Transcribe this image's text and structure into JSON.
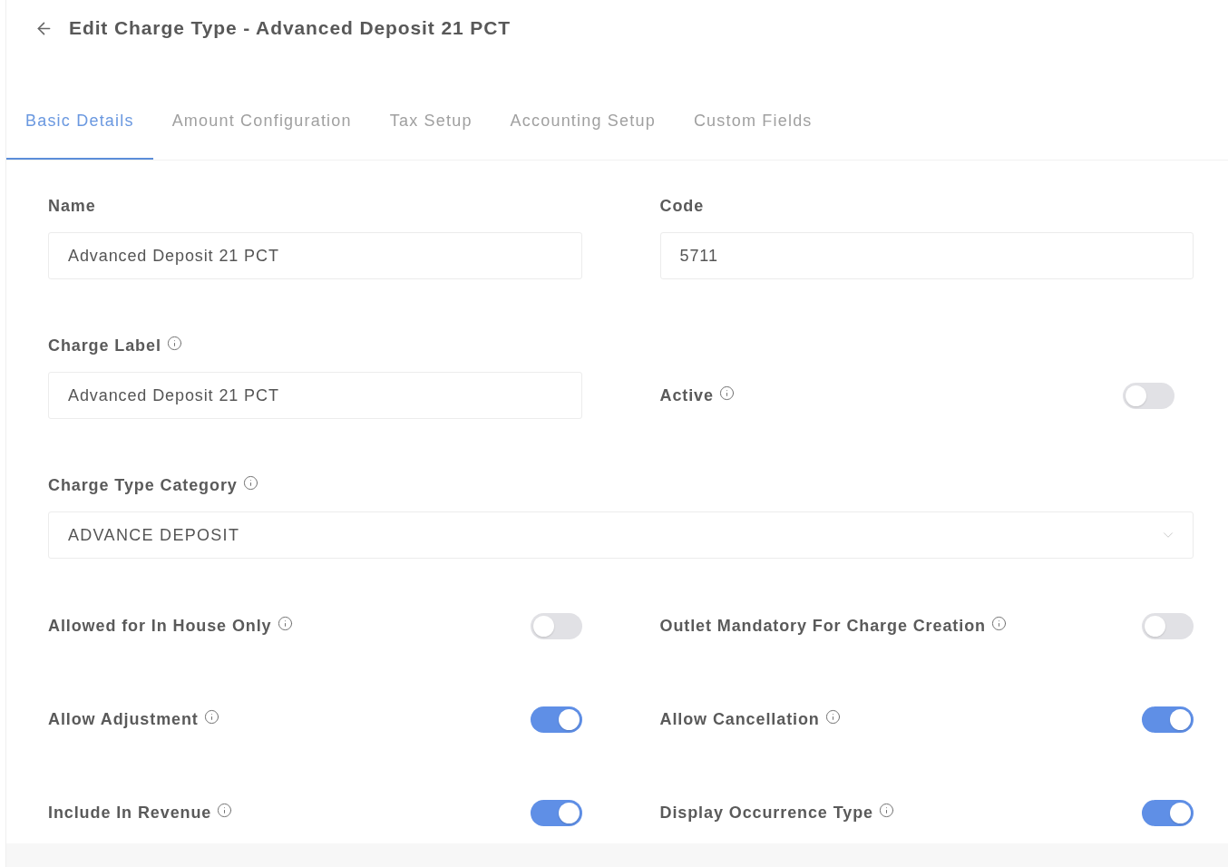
{
  "header": {
    "title": "Edit Charge Type - Advanced Deposit 21 PCT"
  },
  "tabs": [
    {
      "label": "Basic Details",
      "selected": true
    },
    {
      "label": "Amount Configuration",
      "selected": false
    },
    {
      "label": "Tax Setup",
      "selected": false
    },
    {
      "label": "Accounting Setup",
      "selected": false
    },
    {
      "label": "Custom Fields",
      "selected": false
    }
  ],
  "form": {
    "rows": [
      {
        "fields": [
          {
            "kind": "text",
            "label": "Name",
            "info": false,
            "value": "Advanced Deposit 21 PCT"
          },
          {
            "kind": "text",
            "label": "Code",
            "info": false,
            "value": "5711"
          }
        ]
      },
      {
        "fields": [
          {
            "kind": "text",
            "label": "Charge Label",
            "info": true,
            "value": "Advanced Deposit 21 PCT"
          },
          {
            "kind": "toggle",
            "label": "Active",
            "info": true,
            "on": false
          }
        ]
      },
      {
        "fields": [
          {
            "kind": "select",
            "label": "Charge Type Category",
            "info": true,
            "value": "ADVANCE DEPOSIT"
          }
        ]
      },
      {
        "fields": [
          {
            "kind": "toggle",
            "label": "Allowed for In House Only",
            "info": true,
            "on": false
          },
          {
            "kind": "toggle",
            "label": "Outlet Mandatory For Charge Creation",
            "info": true,
            "on": false
          }
        ]
      },
      {
        "fields": [
          {
            "kind": "toggle",
            "label": "Allow Adjustment",
            "info": true,
            "on": true
          },
          {
            "kind": "toggle",
            "label": "Allow Cancellation",
            "info": true,
            "on": true
          }
        ]
      },
      {
        "fields": [
          {
            "kind": "toggle",
            "label": "Include In Revenue",
            "info": true,
            "on": true
          },
          {
            "kind": "toggle",
            "label": "Display Occurrence Type",
            "info": true,
            "on": true
          }
        ]
      }
    ]
  }
}
